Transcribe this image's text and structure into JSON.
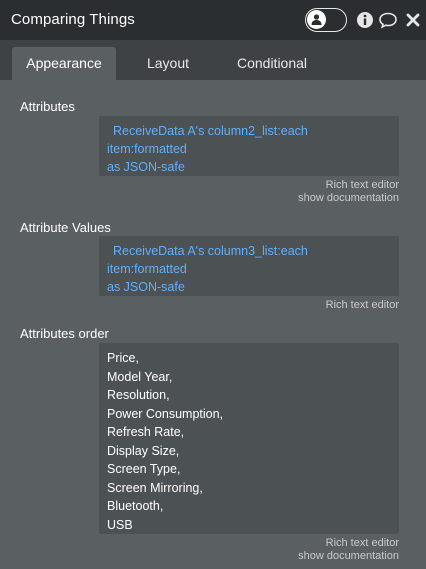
{
  "header": {
    "title": "Comparing Things",
    "icons": [
      "user-toggle",
      "info-icon",
      "comment-icon",
      "close-icon"
    ]
  },
  "tabs": [
    {
      "label": "Appearance",
      "active": true
    },
    {
      "label": "Layout",
      "active": false
    },
    {
      "label": "Conditional",
      "active": false
    }
  ],
  "sections": {
    "attributes": {
      "label": "Attributes",
      "value_line1": "ReceiveData A's column2_list:each item:formatted",
      "value_line2": "as JSON-safe",
      "rich_text": "Rich text editor",
      "docs": "show documentation"
    },
    "attribute_values": {
      "label": "Attribute Values",
      "value_line1": "ReceiveData A's column3_list:each item:formatted",
      "value_line2": "as JSON-safe",
      "rich_text": "Rich text editor"
    },
    "attributes_order": {
      "label": "Attributes order",
      "items": [
        "Price,",
        "Model Year,",
        "Resolution,",
        "Power Consumption,",
        "Refresh Rate,",
        "Display Size,",
        "Screen Type,",
        "Screen Mirroring,",
        "Bluetooth,",
        "USB"
      ],
      "rich_text": "Rich text editor",
      "docs": "show documentation"
    }
  },
  "colors": {
    "panel": "#5a5f61",
    "header": "#2b2e30",
    "tabbar": "#3e4244",
    "field": "#4c5153",
    "dynamic_text": "#5fb0ff"
  }
}
